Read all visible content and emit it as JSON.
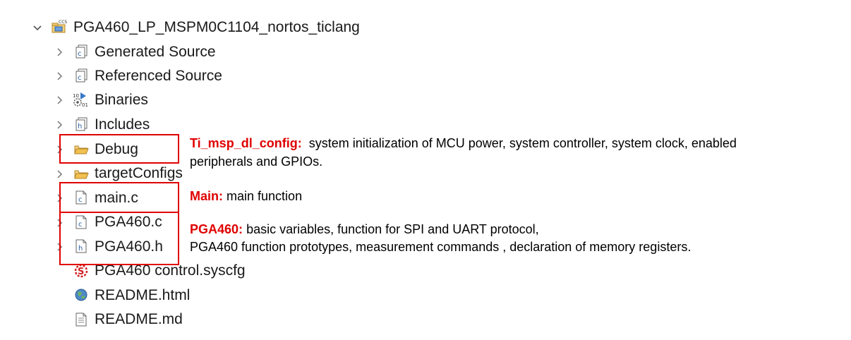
{
  "tree": {
    "project": {
      "label": "PGA460_LP_MSPM0C1104_nortos_ticlang",
      "icon": "ccs-project-icon"
    },
    "items": [
      {
        "label": "Generated Source",
        "icon": "source-folder-icon",
        "expandable": true
      },
      {
        "label": "Referenced Source",
        "icon": "source-folder-icon",
        "expandable": true
      },
      {
        "label": "Binaries",
        "icon": "binaries-icon",
        "expandable": true
      },
      {
        "label": "Includes",
        "icon": "includes-icon",
        "expandable": true
      },
      {
        "label": "Debug",
        "icon": "folder-icon",
        "expandable": true
      },
      {
        "label": "targetConfigs",
        "icon": "folder-icon",
        "expandable": true
      },
      {
        "label": "main.c",
        "icon": "c-file-icon",
        "expandable": true
      },
      {
        "label": "PGA460.c",
        "icon": "c-file-icon",
        "expandable": true
      },
      {
        "label": "PGA460.h",
        "icon": "h-file-icon",
        "expandable": true
      },
      {
        "label": "PGA460 control.syscfg",
        "icon": "syscfg-icon",
        "expandable": false
      },
      {
        "label": "README.html",
        "icon": "html-globe-icon",
        "expandable": false
      },
      {
        "label": "README.md",
        "icon": "text-file-icon",
        "expandable": false
      }
    ]
  },
  "annotations": {
    "config": {
      "title": "Ti_msp_dl_config:",
      "line1": "system initialization of MCU power, system controller, system clock, enabled",
      "line2": "peripherals and GPIOs."
    },
    "main": {
      "title": "Main:",
      "line1": "main function"
    },
    "pga": {
      "title": "PGA460:",
      "line1": "basic variables, function for SPI and UART protocol,",
      "line2": "PGA460 function prototypes, measurement commands , declaration of memory registers."
    }
  },
  "colors": {
    "highlight": "#e00000",
    "text": "#1a1a1a",
    "folder": "#e8b84a"
  }
}
